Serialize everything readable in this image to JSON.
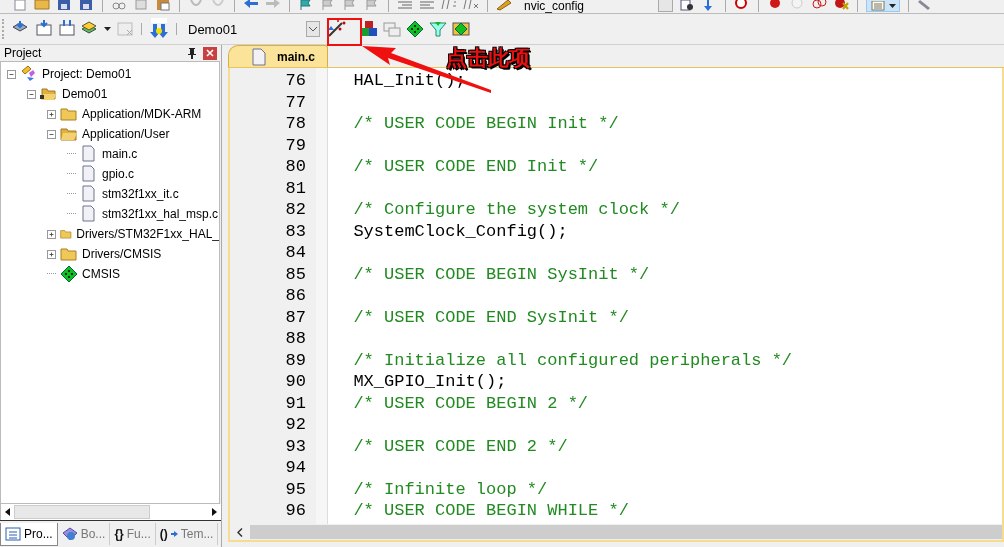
{
  "toolbar_top": {
    "target_combo": "nvic_config"
  },
  "toolbar": {
    "target_combo": "Demo01"
  },
  "project_panel": {
    "title": "Project",
    "tree": [
      {
        "label": "Project: Demo01",
        "kind": "project",
        "expanded": true,
        "children": [
          {
            "label": "Demo01",
            "kind": "target",
            "expanded": true,
            "children": [
              {
                "label": "Application/MDK-ARM",
                "kind": "folder",
                "expanded": false
              },
              {
                "label": "Application/User",
                "kind": "folder",
                "expanded": true,
                "children": [
                  {
                    "label": "main.c",
                    "kind": "file"
                  },
                  {
                    "label": "gpio.c",
                    "kind": "file"
                  },
                  {
                    "label": "stm32f1xx_it.c",
                    "kind": "file"
                  },
                  {
                    "label": "stm32f1xx_hal_msp.c",
                    "kind": "file"
                  }
                ]
              },
              {
                "label": "Drivers/STM32F1xx_HAL_",
                "kind": "folder",
                "expanded": false
              },
              {
                "label": "Drivers/CMSIS",
                "kind": "folder",
                "expanded": false
              },
              {
                "label": "CMSIS",
                "kind": "component"
              }
            ]
          }
        ]
      }
    ],
    "tabs": [
      {
        "label": "Pro...",
        "kind": "project",
        "selected": true
      },
      {
        "label": "Bo...",
        "kind": "books",
        "selected": false
      },
      {
        "label": "Fu...",
        "kind": "functions",
        "glyph": "{}",
        "selected": false
      },
      {
        "label": "Tem...",
        "kind": "templates",
        "glyph": "()",
        "selected": false
      }
    ]
  },
  "editor": {
    "tabs": [
      {
        "label": "main.c",
        "selected": true
      }
    ],
    "lines": [
      {
        "number": "76",
        "text": "  HAL_Init();",
        "kind": "code"
      },
      {
        "number": "77"
      },
      {
        "number": "78",
        "text": "  /* USER CODE BEGIN Init */",
        "kind": "comment"
      },
      {
        "number": "79"
      },
      {
        "number": "80",
        "text": "  /* USER CODE END Init */",
        "kind": "comment"
      },
      {
        "number": "81"
      },
      {
        "number": "82",
        "text": "  /* Configure the system clock */",
        "kind": "comment"
      },
      {
        "number": "83",
        "text": "  SystemClock_Config();",
        "kind": "code"
      },
      {
        "number": "84"
      },
      {
        "number": "85",
        "text": "  /* USER CODE BEGIN SysInit */",
        "kind": "comment"
      },
      {
        "number": "86"
      },
      {
        "number": "87",
        "text": "  /* USER CODE END SysInit */",
        "kind": "comment"
      },
      {
        "number": "88"
      },
      {
        "number": "89",
        "text": "  /* Initialize all configured peripherals */",
        "kind": "comment"
      },
      {
        "number": "90",
        "text": "  MX_GPIO_Init();",
        "kind": "code"
      },
      {
        "number": "91",
        "text": "  /* USER CODE BEGIN 2 */",
        "kind": "comment"
      },
      {
        "number": "92"
      },
      {
        "number": "93",
        "text": "  /* USER CODE END 2 */",
        "kind": "comment"
      },
      {
        "number": "94"
      },
      {
        "number": "95",
        "text": "  /* Infinite loop */",
        "kind": "comment"
      },
      {
        "number": "96",
        "text": "  /* USER CODE BEGIN WHILE */",
        "kind": "comment"
      }
    ]
  },
  "annotation": {
    "text": "点击此项"
  }
}
